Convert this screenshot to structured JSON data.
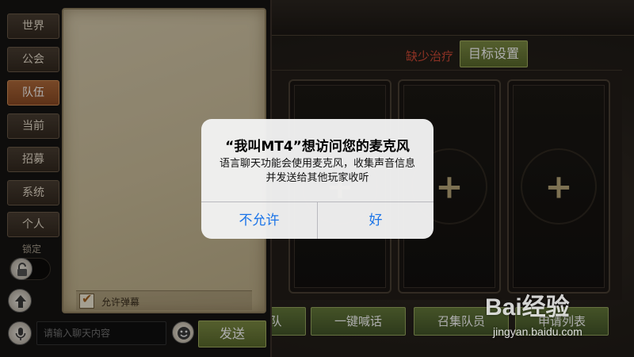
{
  "chat": {
    "channels": [
      "世界",
      "公会",
      "队伍",
      "当前",
      "招募",
      "系统",
      "个人"
    ],
    "active_channel": "队伍",
    "lock_label": "锁定",
    "allow_popup_label": "允许弹幕",
    "allow_popup_checked": true,
    "input_placeholder": "请输入聊天内容",
    "send_label": "发送"
  },
  "team": {
    "warning_text": "缺少治疗",
    "target_settings_label": "目标设置",
    "slot_plus": "+",
    "bottom_buttons": [
      "队",
      "一键喊话",
      "召集队员",
      "申请列表"
    ]
  },
  "dialog": {
    "title": "“我叫MT4”想访问您的麦克风",
    "message": "语言聊天功能会使用麦克风，收集声音信息并发送给其他玩家收听",
    "deny_label": "不允许",
    "allow_label": "好"
  },
  "watermark": {
    "logo": "Bai经验",
    "url": "jingyan.baidu.com"
  },
  "colors": {
    "active_channel": "#9a5830",
    "green_button": "#6b7b38",
    "warning": "#d24a36",
    "dialog_button_text": "#1b74e8",
    "parchment": "#cfc19e"
  }
}
